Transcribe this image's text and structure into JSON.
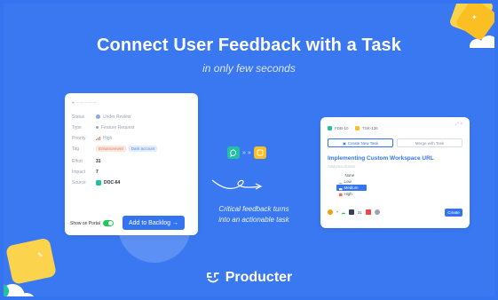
{
  "header": {
    "title": "Connect User Feedback with a Task",
    "subtitle": "in only few seconds"
  },
  "colors": {
    "background": "#3574f0",
    "accent_green": "#22c1a4",
    "accent_yellow": "#fbbf24",
    "button_blue": "#3574f0"
  },
  "left_card": {
    "rows": [
      {
        "label": "Status",
        "value": "Under Review",
        "icon": "status-dot-icon"
      },
      {
        "label": "Type",
        "value": "Feature Request",
        "icon": "type-dot-icon"
      },
      {
        "label": "Priority",
        "value": "High",
        "icon": "priority-bars-icon"
      },
      {
        "label": "Tag",
        "value": "Enhancement",
        "value2": "Dark account"
      },
      {
        "label": "Effort",
        "value": "31"
      },
      {
        "label": "Impact",
        "value": "7"
      },
      {
        "label": "Source",
        "value": "DOC-64",
        "icon": "doc-square-icon"
      }
    ],
    "show_on_portal": "Show on Portal",
    "add_to_backlog": "Add to Backlog →"
  },
  "middle": {
    "caption_line1": "Critical feedback turns",
    "caption_line2": "into an actionable task",
    "chevrons": "» »"
  },
  "right_card": {
    "head_left": "FDB-10",
    "head_right": "TSK-136",
    "create_new_task": "Create New Task",
    "merge_with_task": "Merge with Task",
    "task_title": "Implementing Custom Workspace URL",
    "add_description": "Add description",
    "priorities": [
      "None",
      "Low",
      "Medium",
      "High"
    ],
    "selected_priority": "Medium",
    "footer_number": "31",
    "create_label": "Create"
  },
  "brand": {
    "name": "Producter"
  }
}
